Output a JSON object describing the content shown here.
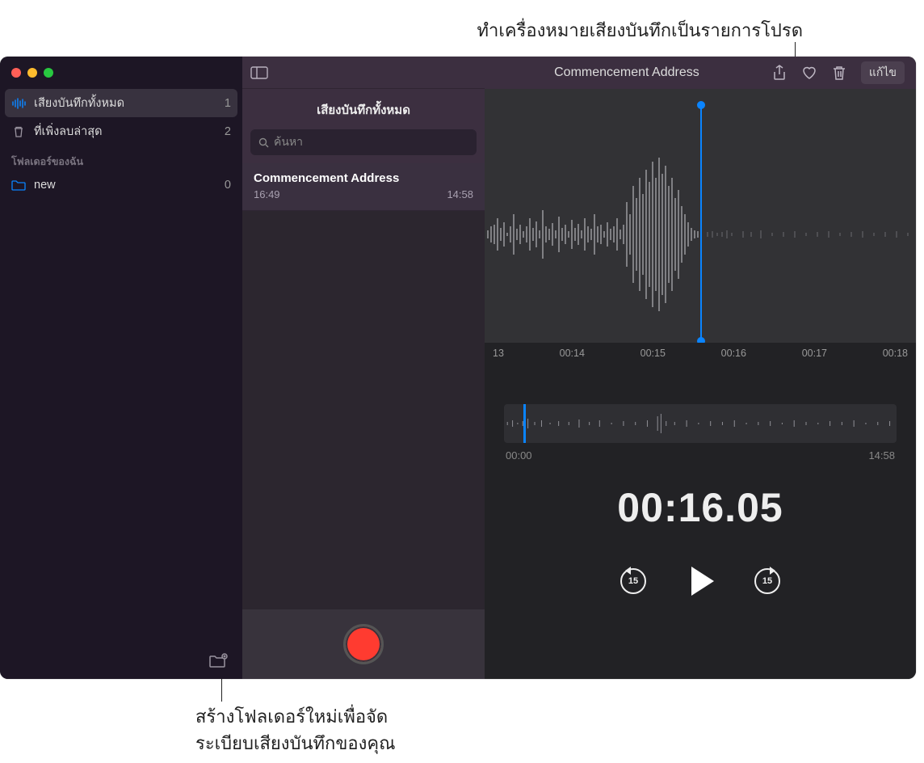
{
  "callouts": {
    "top": "ทำเครื่องหมายเสียงบันทึกเป็นรายการโปรด",
    "bottom_line1": "สร้างโฟลเดอร์ใหม่เพื่อจัด",
    "bottom_line2": "ระเบียบเสียงบันทึกของคุณ"
  },
  "sidebar": {
    "items": [
      {
        "label": "เสียงบันทึกทั้งหมด",
        "count": "1",
        "icon": "waveform",
        "selected": true
      },
      {
        "label": "ที่เพิ่งลบล่าสุด",
        "count": "2",
        "icon": "trash",
        "selected": false
      }
    ],
    "section_label": "โฟลเดอร์ของฉัน",
    "folders": [
      {
        "label": "new",
        "count": "0"
      }
    ]
  },
  "middle": {
    "header": "เสียงบันทึกทั้งหมด",
    "search_placeholder": "ค้นหา",
    "recording": {
      "title": "Commencement Address",
      "time": "16:49",
      "duration": "14:58"
    }
  },
  "toolbar": {
    "title": "Commencement Address",
    "edit": "แก้ไข"
  },
  "ruler": {
    "ticks": [
      "13",
      "00:14",
      "00:15",
      "00:16",
      "00:17",
      "00:18"
    ]
  },
  "mini": {
    "start": "00:00",
    "end": "14:58"
  },
  "current_time": "00:16.05",
  "skip_seconds": "15",
  "colors": {
    "accent": "#0a84ff",
    "record": "#ff3b30"
  }
}
